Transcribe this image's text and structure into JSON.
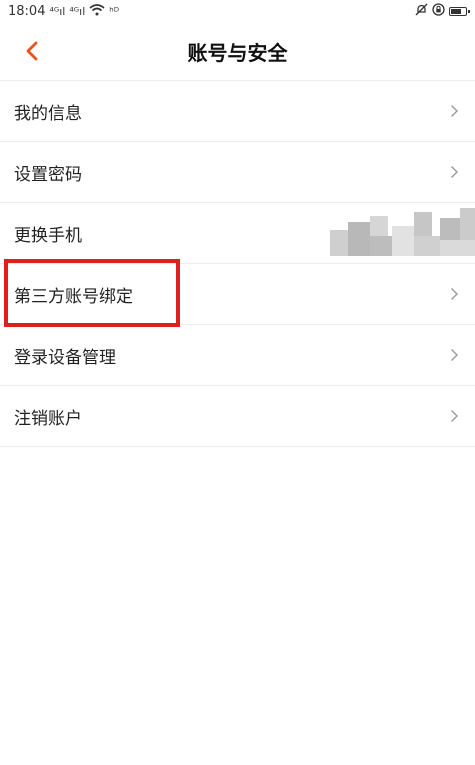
{
  "status_bar": {
    "time": "18:04",
    "signal1": "⁴ᴳıl",
    "signal2": "⁴ᴳıl",
    "wifi_icon": "wifi-icon",
    "data_badge": "ʰᴰ"
  },
  "header": {
    "title": "账号与安全",
    "back_icon": "chevron-left-icon",
    "accent_color": "#e8541a"
  },
  "menu": {
    "items": [
      {
        "label": "我的信息"
      },
      {
        "label": "设置密码"
      },
      {
        "label": "更换手机"
      },
      {
        "label": "第三方账号绑定"
      },
      {
        "label": "登录设备管理"
      },
      {
        "label": "注销账户"
      }
    ]
  },
  "annotation": {
    "highlight_color": "#e02020"
  }
}
